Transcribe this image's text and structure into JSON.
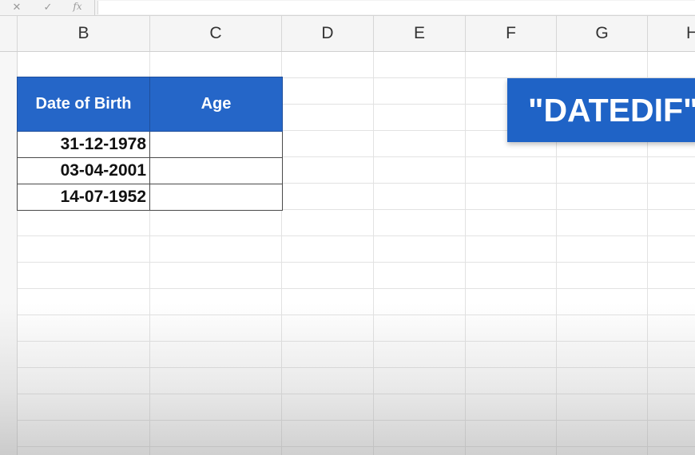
{
  "formula_bar": {
    "cancel_glyph": "✕",
    "confirm_glyph": "✓",
    "fx_glyph": "fx",
    "value": ""
  },
  "columns": [
    "B",
    "C",
    "D",
    "E",
    "F",
    "G",
    "H"
  ],
  "table": {
    "headers": [
      "Date of Birth",
      "Age"
    ],
    "rows": [
      [
        "31-12-1978",
        ""
      ],
      [
        "03-04-2001",
        ""
      ],
      [
        "14-07-1952",
        ""
      ]
    ],
    "header_color": "#2566c8"
  },
  "callout": {
    "text": "\"DATEDIF\"",
    "color": "#1f63c6"
  }
}
